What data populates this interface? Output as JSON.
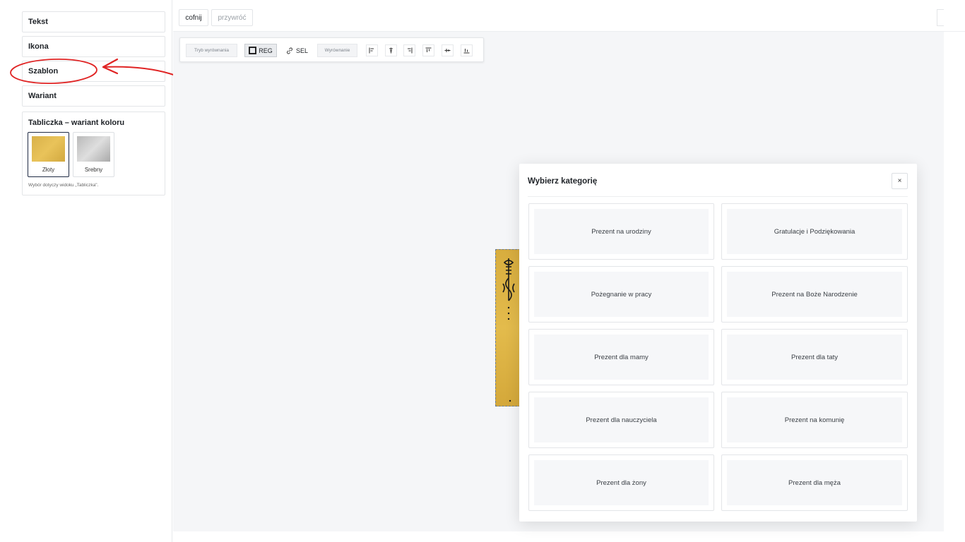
{
  "sidebar": {
    "items": [
      {
        "label": "Tekst"
      },
      {
        "label": "Ikona"
      },
      {
        "label": "Szablon"
      },
      {
        "label": "Wariant"
      }
    ],
    "color_panel": {
      "title": "Tabliczka – wariant koloru",
      "swatches": [
        {
          "label": "Złoty",
          "color": "#e0b84c",
          "selected": true
        },
        {
          "label": "Srebny",
          "color": "#c9c9c9",
          "selected": false
        }
      ],
      "note": "Wybór dotyczy widoku „Tabliczka\"."
    }
  },
  "toolbar": {
    "undo_label": "cofnij",
    "redo_label": "przywróć"
  },
  "align_bar": {
    "mode_label": "Tryb wyrównania",
    "reg_label": "REG",
    "sel_label": "SEL",
    "align_label": "Wyrównanie",
    "icons": [
      "align-left-icon",
      "align-center-icon",
      "align-right-icon",
      "align-top-icon",
      "align-middle-icon",
      "align-bottom-icon"
    ]
  },
  "modal": {
    "title": "Wybierz kategorię",
    "close_label": "×",
    "categories": [
      "Prezent na urodziny",
      "Gratulacje i Podziękowania",
      "Pożegnanie w pracy",
      "Prezent na Boże Narodzenie",
      "Prezent dla mamy",
      "Prezent dla taty",
      "Prezent dla nauczyciela",
      "Prezent na komunię",
      "Prezent dla żony",
      "Prezent dla męża"
    ]
  },
  "colors": {
    "accent_dark": "#1e2a44",
    "annotation_red": "#e02424",
    "plate_gold": "#dcb245"
  }
}
